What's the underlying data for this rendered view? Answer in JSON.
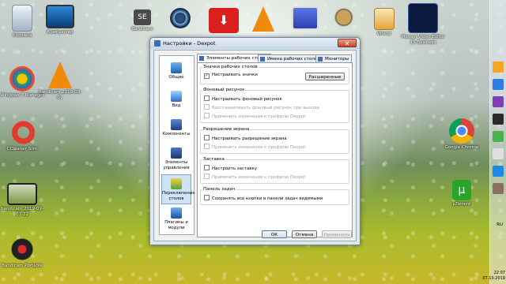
{
  "desktop": {
    "icons": [
      {
        "label": "Корзина",
        "icon": "recycle-bin-icon"
      },
      {
        "label": "Компьютер",
        "icon": "computer-icon"
      },
      {
        "label": "Bandicam",
        "icon": "se-app-icon"
      },
      {
        "label": "",
        "icon": "gear-app-icon"
      },
      {
        "label": "",
        "icon": "download-app-icon"
      },
      {
        "label": "",
        "icon": "vlc-icon"
      },
      {
        "label": "",
        "icon": "monitor-app-icon"
      },
      {
        "label": "",
        "icon": "gimp-icon"
      },
      {
        "label": "Winrar",
        "icon": "winrar-icon"
      },
      {
        "label": "Movavi Video Editor 15 Business",
        "icon": "movavi-icon"
      },
      {
        "label": "Windows 7 Manager",
        "icon": "windows-manager-icon"
      },
      {
        "label": "Bandicam 2019-09-07",
        "icon": "vlc-file-icon"
      },
      {
        "label": "CCleaner Slim",
        "icon": "ccleaner-icon"
      },
      {
        "label": "bandicam 2019-09-07 22",
        "icon": "video-file-icon"
      },
      {
        "label": "Bandicam Portable",
        "icon": "bandicam-icon"
      },
      {
        "label": "Google Chrome",
        "icon": "chrome-icon"
      },
      {
        "label": "µTorrent",
        "icon": "utorrent-icon"
      }
    ]
  },
  "dialog": {
    "title": "Настройки - Dexpot",
    "close_label": "✕",
    "sidebar": [
      {
        "label": "Общие",
        "icon": "general-icon"
      },
      {
        "label": "Вид",
        "icon": "view-icon"
      },
      {
        "label": "Компоненты",
        "icon": "components-icon"
      },
      {
        "label": "Элементы управления",
        "icon": "controls-icon"
      },
      {
        "label": "Переключение столов",
        "icon": "desktop-switch-icon"
      },
      {
        "label": "Плагины и модули",
        "icon": "plugins-icon"
      }
    ],
    "tabs": [
      "Элементы рабочих столов",
      "Имена рабочих столов",
      "Мониторы"
    ],
    "groups": {
      "icons": {
        "title": "Значки рабочих столов",
        "check": "Настраивать значки",
        "checked": true,
        "button": "Расширенные"
      },
      "wallpaper": {
        "title": "Фоновый рисунок",
        "items": [
          {
            "label": "Настраивать фоновый рисунок",
            "enabled": true
          },
          {
            "label": "Восстанавливать фоновый рисунок при выходе",
            "enabled": false
          },
          {
            "label": "Применить изменения к профилю Dexpot",
            "enabled": false
          }
        ]
      },
      "resolution": {
        "title": "Разрешение экрана",
        "items": [
          {
            "label": "Настраивать разрешение экрана",
            "enabled": true
          },
          {
            "label": "Применить изменения к профилю Dexpot",
            "enabled": false
          }
        ]
      },
      "screensaver": {
        "title": "Заставка",
        "items": [
          {
            "label": "Настроить заставку",
            "enabled": true
          },
          {
            "label": "Применить изменения к профилю Dexpot",
            "enabled": false
          }
        ]
      },
      "taskbar": {
        "title": "Панель задач",
        "items": [
          {
            "label": "Сохранять все кнопки в панели задач видимыми",
            "enabled": true
          }
        ]
      }
    },
    "buttons": {
      "ok": "ОК",
      "cancel": "Отмена",
      "apply": "Применить"
    }
  },
  "tray": {
    "lang": "RU",
    "time": "22:07",
    "date": "07.10.2019"
  }
}
